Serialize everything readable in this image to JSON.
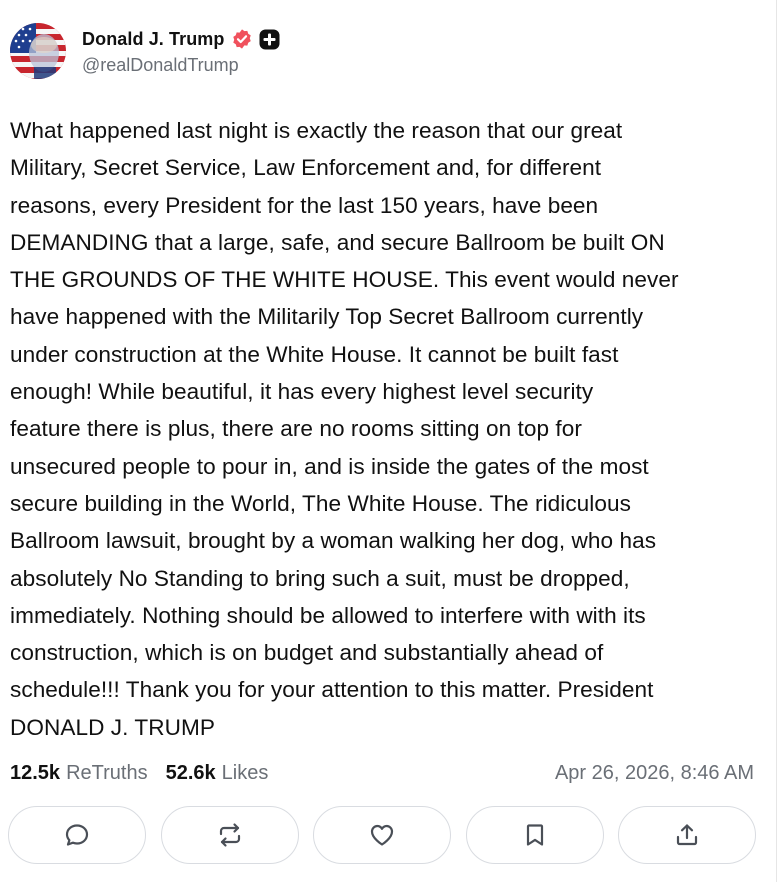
{
  "author": {
    "display_name": "Donald J. Trump",
    "handle": "@realDonaldTrump",
    "avatar_icon": "flag-portrait-avatar",
    "verified_icon": "verified-badge-icon",
    "plus_icon": "plus-badge-icon"
  },
  "post": {
    "text": "What happened last night is exactly the reason that our great\nMilitary, Secret Service, Law Enforcement and, for different\nreasons, every President for the last 150 years, have been\nDEMANDING that a large, safe, and secure Ballroom be built ON\nTHE GROUNDS OF THE WHITE HOUSE. This event would never\nhave happened with the Militarily Top Secret Ballroom currently\nunder construction at the White House. It cannot be built fast\nenough! While beautiful, it has every highest level security\nfeature there is plus, there are no rooms sitting on top for\nunsecured people to pour in, and is inside the gates of the most\nsecure building in the World, The White House. The ridiculous\nBallroom lawsuit, brought by a woman walking her dog, who has\nabsolutely No Standing to bring such a suit, must be dropped,\nimmediately. Nothing should be allowed to interfere with with its\nconstruction, which is on budget and substantially ahead of\nschedule!!! Thank you for your attention to this matter. President\nDONALD J. TRUMP"
  },
  "stats": {
    "retruths_count": "12.5k",
    "retruths_label": "ReTruths",
    "likes_count": "52.6k",
    "likes_label": "Likes",
    "timestamp": "Apr 26, 2026, 8:46 AM"
  },
  "actions": [
    {
      "icon": "reply-icon"
    },
    {
      "icon": "retruth-icon"
    },
    {
      "icon": "like-icon"
    },
    {
      "icon": "bookmark-icon"
    },
    {
      "icon": "share-icon"
    }
  ],
  "colors": {
    "verified_badge": "#f0515d",
    "text_primary": "#111111",
    "text_secondary": "#6a6f76",
    "border": "#d9dce1"
  }
}
